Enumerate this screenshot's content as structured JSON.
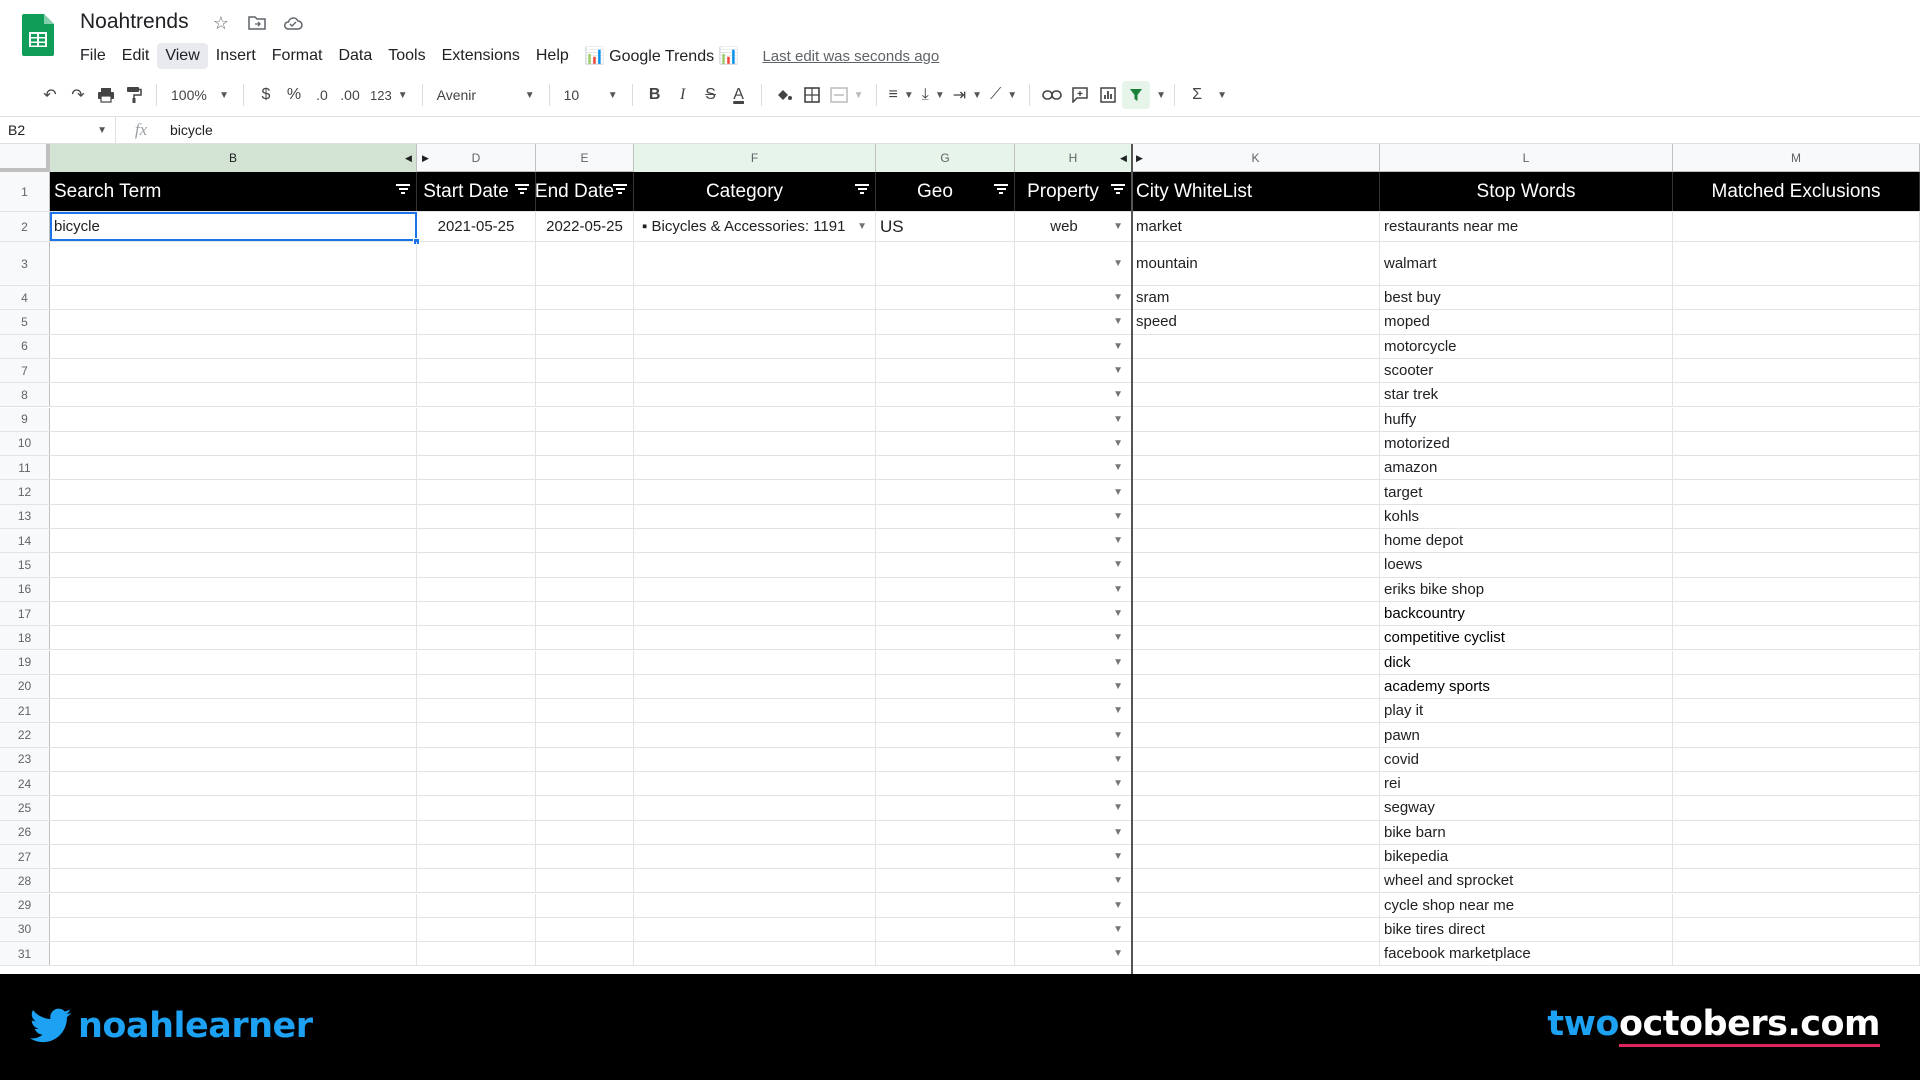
{
  "app": {
    "title": "Noahtrends",
    "menu": [
      "File",
      "Edit",
      "View",
      "Insert",
      "Format",
      "Data",
      "Tools",
      "Extensions",
      "Help",
      "📊 Google Trends 📊"
    ],
    "active_menu": "View",
    "last_edit": "Last edit was seconds ago"
  },
  "toolbar": {
    "zoom": "100%",
    "currency": "$",
    "percent": "%",
    "dec_decrease": ".0",
    "dec_increase": ".00",
    "more_formats": "123",
    "font": "Avenir",
    "font_size": "10",
    "bold": "B",
    "italic": "I",
    "strike": "S",
    "text_color": "A",
    "sum": "Σ"
  },
  "formula_bar": {
    "name_box": "B2",
    "fx": "fx",
    "value": "bicycle"
  },
  "columns": [
    {
      "letter": "B",
      "key": "b"
    },
    {
      "letter": "D",
      "key": "d"
    },
    {
      "letter": "E",
      "key": "e"
    },
    {
      "letter": "F",
      "key": "f"
    },
    {
      "letter": "G",
      "key": "g"
    },
    {
      "letter": "H",
      "key": "h"
    },
    {
      "letter": "K",
      "key": "k"
    },
    {
      "letter": "L",
      "key": "l"
    },
    {
      "letter": "M",
      "key": "m"
    }
  ],
  "header_row": {
    "search_term": "Search Term",
    "start_date": "Start Date",
    "end_date": "End Date",
    "category": "Category",
    "geo": "Geo",
    "property": "Property",
    "city_whitelist": "City WhiteList",
    "stop_words": "Stop Words",
    "matched_exclusions": "Matched Exclusions"
  },
  "row2": {
    "search_term": "bicycle",
    "start_date": "2021-05-25",
    "end_date": "2022-05-25",
    "category": "▪ Bicycles & Accessories: 1191",
    "geo": "US",
    "property": "web"
  },
  "city_whitelist": [
    "market",
    "mountain",
    "sram",
    "speed"
  ],
  "stop_words": [
    "restaurants near me",
    "walmart",
    "best buy",
    "moped",
    "motorcycle",
    "scooter",
    "star trek",
    "huffy",
    "motorized",
    "amazon",
    "target",
    "kohls",
    "home depot",
    "loews",
    "eriks bike shop",
    "backcountry",
    "competitive cyclist",
    "dick",
    "academy sports",
    "play it",
    "pawn",
    "covid",
    "rei",
    "segway",
    "bike barn",
    "bikepedia",
    "wheel and sprocket",
    "cycle shop near me",
    "bike tires direct",
    "facebook marketplace"
  ],
  "bold_stop_words": [
    "backcountry",
    "competitive cyclist",
    "dick",
    "academy sports"
  ],
  "row_numbers": [
    1,
    2,
    3,
    4,
    5,
    6,
    7,
    8,
    9,
    10,
    11,
    12,
    13,
    14,
    15,
    16,
    17,
    18,
    19,
    20,
    21,
    22,
    23,
    24,
    25,
    26,
    27,
    28,
    29,
    30,
    31
  ],
  "footer": {
    "twitter_handle": "noahlearner",
    "site_part1": "two",
    "site_part2": "octobers.com"
  },
  "colors": {
    "accent_blue": "#1a73e8",
    "twitter_blue": "#1da1f2",
    "sheets_green": "#0f9d58",
    "underline_red": "#e0245e"
  }
}
